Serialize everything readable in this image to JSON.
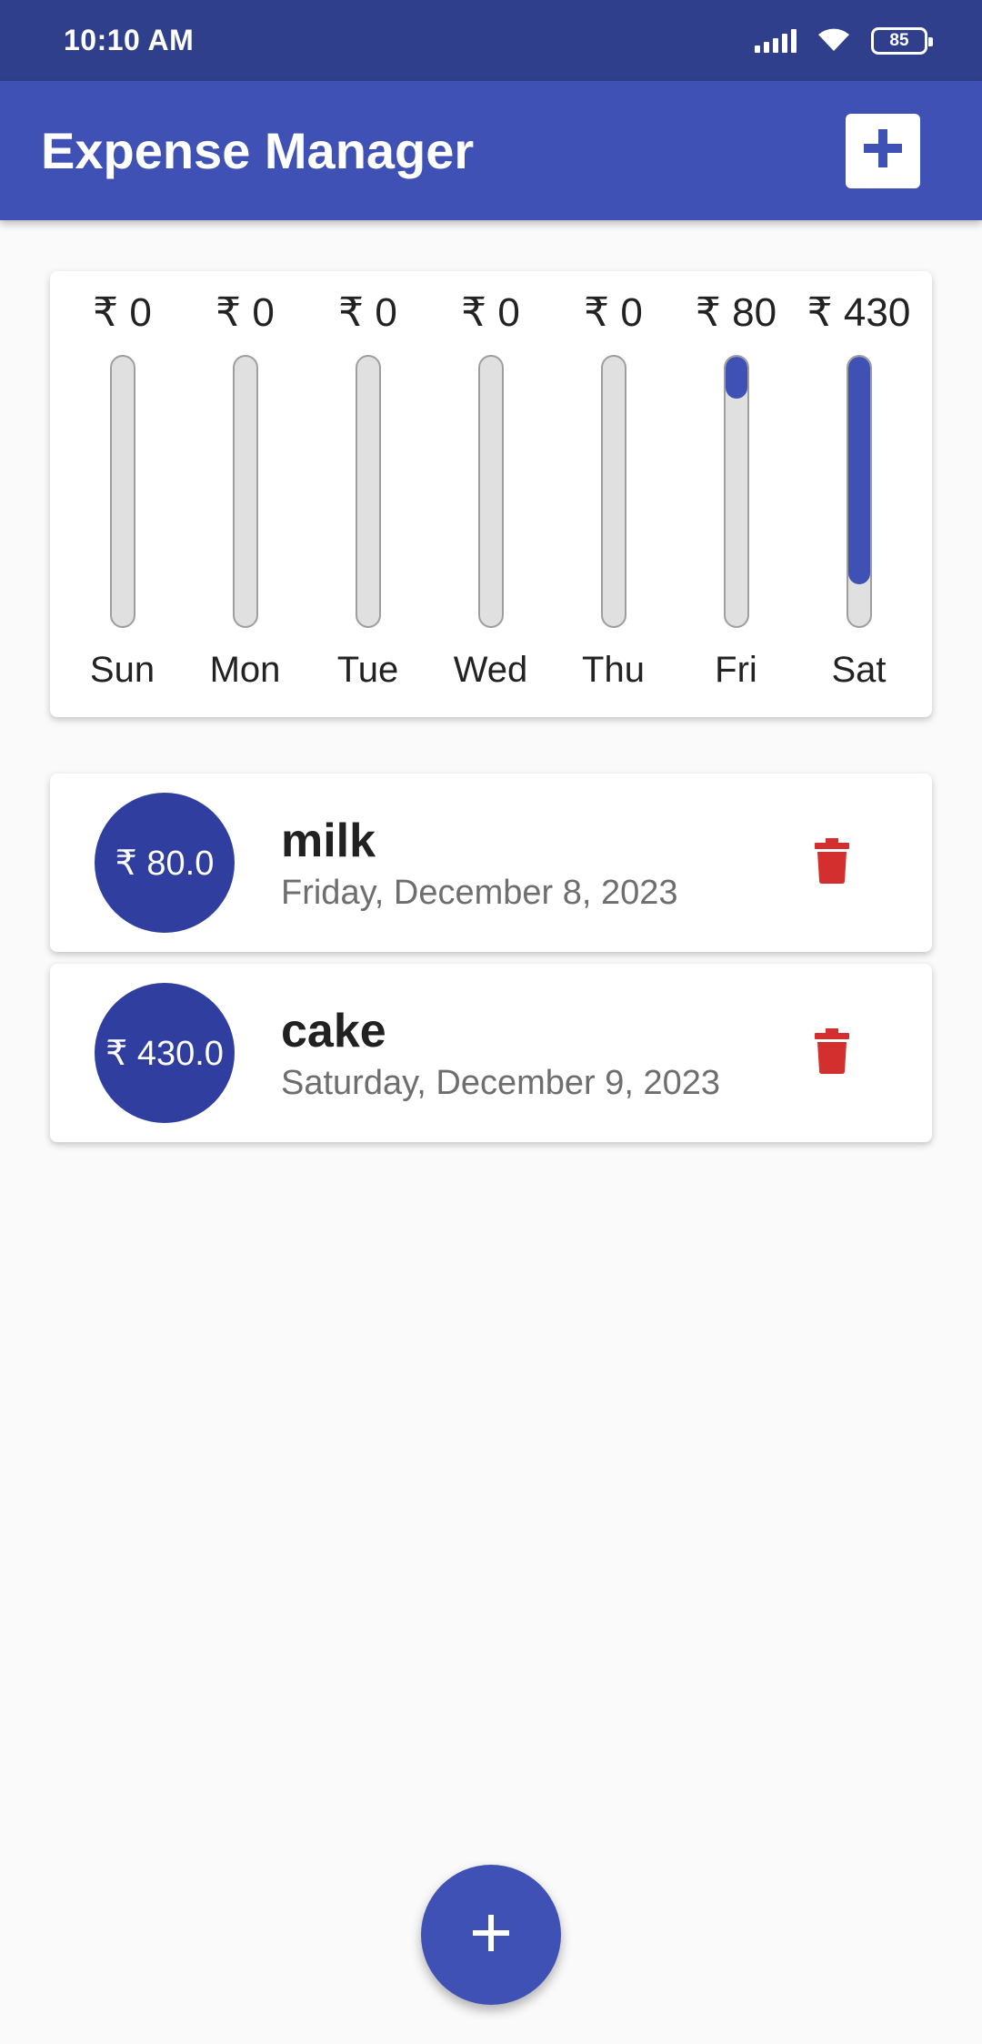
{
  "status_bar": {
    "time": "10:10 AM",
    "battery": "85",
    "icons": [
      "signal-icon",
      "wifi-icon",
      "battery-icon"
    ]
  },
  "app_bar": {
    "title": "Expense Manager",
    "add_icon": "plus-icon"
  },
  "chart_data": {
    "type": "bar",
    "categories": [
      "Sun",
      "Mon",
      "Tue",
      "Wed",
      "Thu",
      "Fri",
      "Sat"
    ],
    "values": [
      0,
      0,
      0,
      0,
      0,
      80,
      430
    ],
    "labels": [
      "₹ 0",
      "₹ 0",
      "₹ 0",
      "₹ 0",
      "₹ 0",
      "₹ 80",
      "₹ 430"
    ],
    "fill_fractions": [
      0,
      0,
      0,
      0,
      0,
      0.157,
      0.843
    ],
    "title": "",
    "xlabel": "",
    "ylabel": ""
  },
  "transactions": [
    {
      "amount": "₹ 80.0",
      "title": "milk",
      "date": "Friday, December 8, 2023",
      "delete_icon": "trash-icon"
    },
    {
      "amount": "₹ 430.0",
      "title": "cake",
      "date": "Saturday, December 9, 2023",
      "delete_icon": "trash-icon"
    }
  ],
  "fab": {
    "icon": "plus-icon"
  },
  "colors": {
    "primary": "#3f51b5",
    "primary_dark": "#303f8c",
    "avatar": "#303f9f",
    "delete": "#d32f2f",
    "track": "#e0e0e0"
  }
}
